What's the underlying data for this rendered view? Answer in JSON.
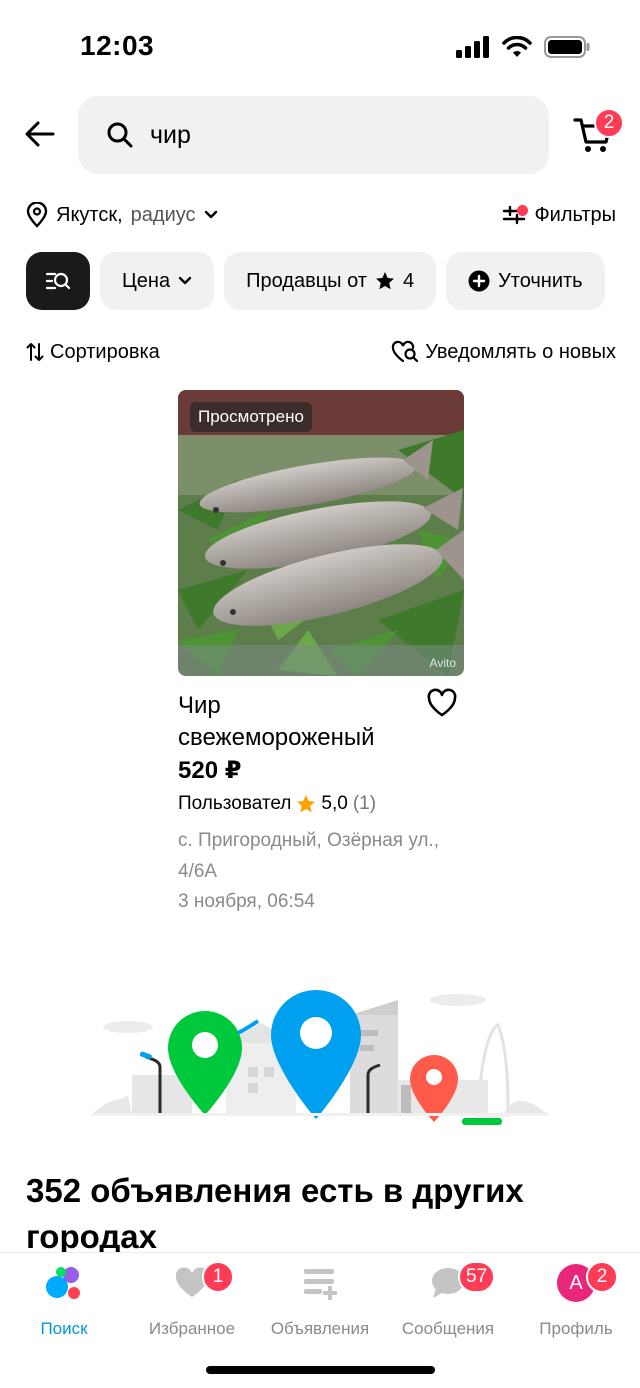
{
  "status": {
    "time": "12:03"
  },
  "search": {
    "query": "чир"
  },
  "cart": {
    "badge": "2"
  },
  "location": {
    "city": "Якутск,",
    "radius": "радиус"
  },
  "filters": {
    "label": "Фильтры"
  },
  "chips": [
    {
      "label": "Цена"
    },
    {
      "label": "Продавцы от",
      "rating": "4"
    },
    {
      "label": "Уточнить"
    }
  ],
  "sort": {
    "label": "Сортировка",
    "notify": "Уведомлять о новых"
  },
  "listing": {
    "viewed": "Просмотрено",
    "title": "Чир свежемороженый",
    "price": "520 ₽",
    "seller": "Пользовател",
    "rating": "5,0",
    "reviews": "(1)",
    "address": "с. Пригородный, Озёрная ул., 4/6А",
    "date": "3 ноября, 06:54",
    "watermark": "Avito"
  },
  "other_cities": {
    "text": "352 объявления есть в других городах"
  },
  "nav": [
    {
      "label": "Поиск",
      "active": true
    },
    {
      "label": "Избранное",
      "badge": "1"
    },
    {
      "label": "Объявления"
    },
    {
      "label": "Сообщения",
      "badge": "57"
    },
    {
      "label": "Профиль",
      "badge": "2",
      "avatar": "А"
    }
  ],
  "colors": {
    "accent": "#0096e0",
    "badge": "#ff3b55",
    "chip_bg": "#f1f1f1",
    "star": "#ffa000"
  }
}
